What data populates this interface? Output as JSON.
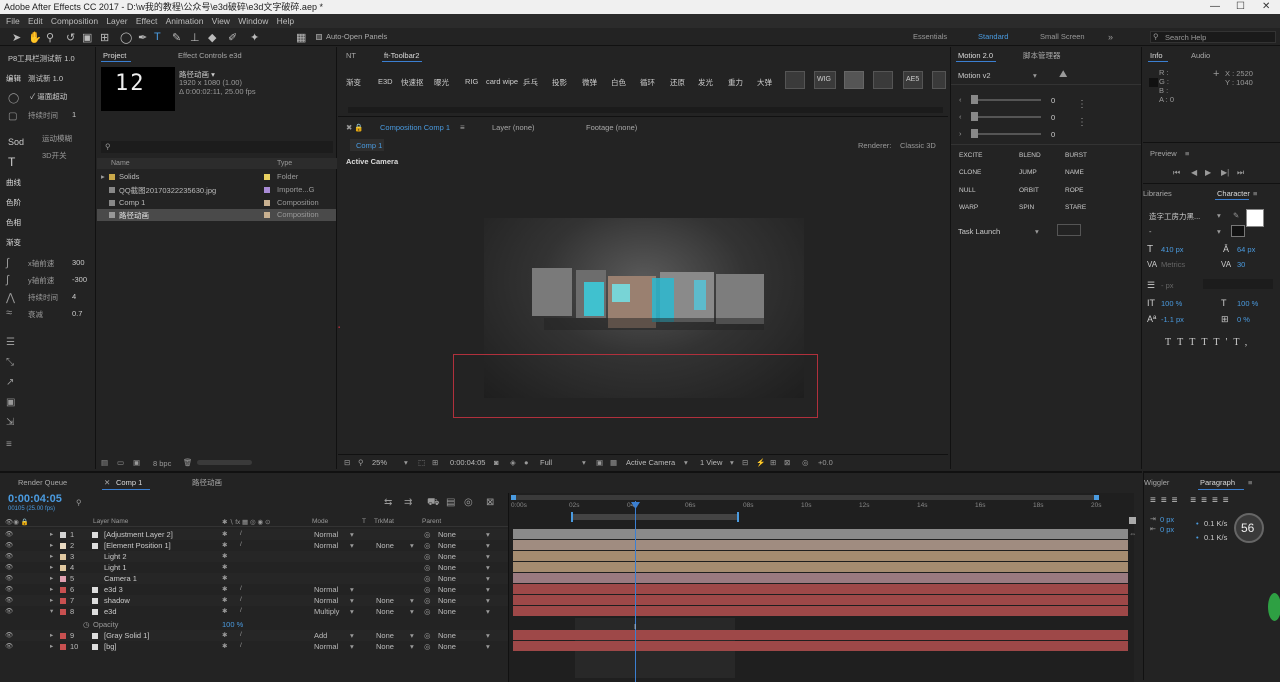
{
  "app": {
    "title": "Adobe After Effects CC 2017 - D:\\w我的教程\\公众号\\e3d破碎\\e3d文字破碎.aep *"
  },
  "menu": [
    "File",
    "Edit",
    "Composition",
    "Layer",
    "Effect",
    "Animation",
    "View",
    "Window",
    "Help"
  ],
  "toolbar": {
    "auto_open": "Auto-Open Panels",
    "workspaces": [
      "Essentials",
      "Standard",
      "Small Screen"
    ],
    "search": "Search Help"
  },
  "leftpanel": {
    "title": "P8工具栏测试新 1.0",
    "sub": "测试新 1.0",
    "items": [
      "编辑",
      "曲线",
      "色阶",
      "色相",
      "渐变"
    ],
    "smooth_label": "✓ 逼面超动",
    "dur_label": "持续时间",
    "dur_val": "1",
    "motion_blur": "运动模糊",
    "open3d": "3D开关",
    "xs_label": "x轴前速",
    "xs_val": "300",
    "ys_label": "y轴前速",
    "ys_val": "-300",
    "dur2_label": "持续时间",
    "dur2_val": "4",
    "decay_label": "衰减",
    "decay_val": "0.7"
  },
  "project": {
    "tab": "Project",
    "effect_tab": "Effect Controls e3d",
    "comp_name": "路径动画 ▾",
    "comp_res": "1920 x 1080 (1.00)",
    "comp_dur": "Δ 0:00:02:11, 25.00 fps",
    "thumb": "12",
    "col_name": "Name",
    "col_type": "Type",
    "items": [
      {
        "name": "Solids",
        "type": "Folder",
        "color": "#e8d060"
      },
      {
        "name": "QQ截图20170322235630.jpg",
        "type": "Importe...G",
        "color": "#a98bd6"
      },
      {
        "name": "Comp 1",
        "type": "Composition",
        "color": "#c8b090"
      },
      {
        "name": "路径动画",
        "type": "Composition",
        "color": "#c8b090"
      }
    ],
    "bpc": "8 bpc"
  },
  "fttoolbar": {
    "tabs": [
      "NT",
      "ft-Toolbar2"
    ],
    "buttons": [
      "渐变",
      "E3D",
      "快速抠",
      "曝光",
      "RIG",
      "card wipe",
      "乒乓",
      "投影",
      "微弹",
      "白色",
      "循环",
      "还原",
      "发光",
      "重力",
      "大弹"
    ],
    "icons": [
      "WIG",
      "AE5"
    ]
  },
  "comp": {
    "tab_comp": "Composition Comp 1",
    "tab_layer": "Layer (none)",
    "tab_footage": "Footage (none)",
    "subtab": "Comp 1",
    "renderer": "Renderer:",
    "renderer_val": "Classic 3D",
    "camera": "Active Camera",
    "zoom": "25%",
    "time": "0:00:04:05",
    "quality": "Full",
    "camera_sel": "Active Camera",
    "view": "1 View",
    "offset": "+0.0"
  },
  "motion": {
    "tab": "Motion 2.0",
    "tab2": "脚本管理器",
    "preset": "Motion v2",
    "vals": [
      "0",
      "0",
      "0"
    ],
    "buttons": [
      "EXCITE",
      "BLEND",
      "BURST",
      "CLONE",
      "JUMP",
      "NAME",
      "NULL",
      "ORBIT",
      "ROPE",
      "WARP",
      "SPIN",
      "STARE"
    ],
    "task": "Task Launch"
  },
  "info": {
    "tab": "Info",
    "tab2": "Audio",
    "r": "R :",
    "g": "G :",
    "b": "B :",
    "a": "A : 0",
    "x": "X : 2520",
    "y": "Y : 1040"
  },
  "preview": {
    "title": "Preview"
  },
  "character": {
    "libraries": "Libraries",
    "tab": "Character",
    "font": "造字工房力黑...",
    "style": "-",
    "size": "410 px",
    "leading": "64 px",
    "kern": "Metrics",
    "track": "30",
    "stroke_px": "- px",
    "vscale": "100 %",
    "hscale": "100 %",
    "baseline": "-1.1 px",
    "tsume": "0 %"
  },
  "timeline": {
    "render_queue": "Render Queue",
    "tab_comp": "Comp 1",
    "tab_path": "路径动画",
    "timecode": "0:00:04:05",
    "fps": "00105 (25.00 fps)",
    "cols": {
      "name": "Layer Name",
      "mode": "Mode",
      "t": "T",
      "trkmat": "TrkMat",
      "parent": "Parent"
    },
    "ruler": [
      "0:00s",
      "02s",
      "04s",
      "06s",
      "08s",
      "10s",
      "12s",
      "14s",
      "16s",
      "18s",
      "20s"
    ],
    "layers": [
      {
        "num": "1",
        "name": "[Adjustment Layer 2]",
        "color": "#d4d4d4",
        "mode": "Normal",
        "trk": "",
        "parent": "None",
        "bar": "#8a8a8a"
      },
      {
        "num": "2",
        "name": "[Element Position 1]",
        "color": "#e8d8c0",
        "mode": "Normal",
        "trk": "None",
        "parent": "None",
        "bar": "#a08c80"
      },
      {
        "num": "3",
        "name": "Light 2",
        "color": "#e0c8a0",
        "mode": "",
        "trk": "",
        "parent": "None",
        "bar": "#a58c70"
      },
      {
        "num": "4",
        "name": "Light 1",
        "color": "#e0c8a0",
        "mode": "",
        "trk": "",
        "parent": "None",
        "bar": "#a58c70"
      },
      {
        "num": "5",
        "name": "Camera 1",
        "color": "#e0a0b0",
        "mode": "",
        "trk": "",
        "parent": "None",
        "bar": "#9a7a80"
      },
      {
        "num": "6",
        "name": "e3d 3",
        "color": "#c85050",
        "mode": "Normal",
        "trk": "",
        "parent": "None",
        "bar": "#9e4848"
      },
      {
        "num": "7",
        "name": "shadow",
        "color": "#c85050",
        "mode": "Normal",
        "trk": "None",
        "parent": "None",
        "bar": "#9e4848"
      },
      {
        "num": "8",
        "name": "e3d",
        "color": "#c85050",
        "mode": "Multiply",
        "trk": "None",
        "parent": "None",
        "bar": "#9e4848"
      },
      {
        "num": "9",
        "name": "[Gray Solid 1]",
        "color": "#c85050",
        "mode": "Add",
        "trk": "None",
        "parent": "None",
        "bar": "#9e4848"
      },
      {
        "num": "10",
        "name": "[bg]",
        "color": "#c85050",
        "mode": "Normal",
        "trk": "None",
        "parent": "None",
        "bar": "#9e4848"
      }
    ],
    "opacity_label": "Opacity",
    "opacity_val": "100 %"
  },
  "wiggler": {
    "tab": "Wiggler",
    "tab2": "Paragraph",
    "indent1": "0 px",
    "indent2": "0 px",
    "sp1": "0.1 K/s",
    "sp2": "0.1 K/s",
    "badge": "56"
  }
}
